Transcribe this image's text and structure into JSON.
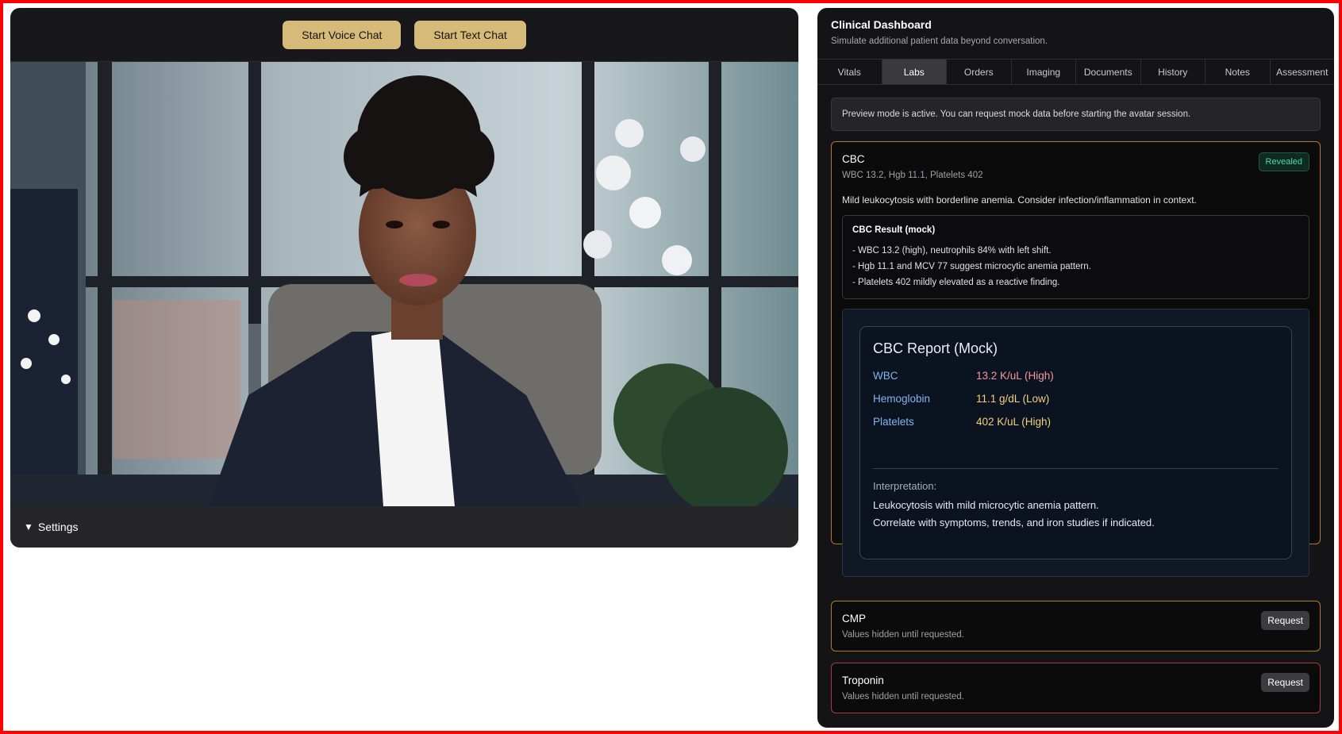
{
  "video": {
    "start_voice_label": "Start Voice Chat",
    "start_text_label": "Start Text Chat",
    "settings_label": "Settings"
  },
  "dashboard": {
    "title": "Clinical Dashboard",
    "subtitle": "Simulate additional patient data beyond conversation.",
    "tabs": [
      {
        "label": "Vitals"
      },
      {
        "label": "Labs"
      },
      {
        "label": "Orders"
      },
      {
        "label": "Imaging"
      },
      {
        "label": "Documents"
      },
      {
        "label": "History"
      },
      {
        "label": "Notes"
      },
      {
        "label": "Assessment"
      }
    ],
    "active_tab": "Labs",
    "notice": "Preview mode is active. You can request mock data before starting the avatar session."
  },
  "cbc": {
    "title": "CBC",
    "values": "WBC 13.2, Hgb 11.1, Platelets 402",
    "status": "Revealed",
    "summary": "Mild leukocytosis with borderline anemia. Consider infection/inflammation in context.",
    "result_title": "CBC Result (mock)",
    "result_lines": [
      "- WBC 13.2 (high), neutrophils 84% with left shift.",
      "- Hgb 11.1 and MCV 77 suggest microcytic anemia pattern.",
      "- Platelets 402 mildly elevated as a reactive finding."
    ],
    "report": {
      "title": "CBC Report (Mock)",
      "rows": [
        {
          "name": "WBC",
          "value": "13.2 K/uL (High)"
        },
        {
          "name": "Hemoglobin",
          "value": "11.1 g/dL (Low)"
        },
        {
          "name": "Platelets",
          "value": "402 K/uL (High)"
        }
      ],
      "interpretation_label": "Interpretation:",
      "interpretation_lines": [
        "Leukocytosis with mild microcytic anemia pattern.",
        "Correlate with symptoms, trends, and iron studies if indicated."
      ]
    }
  },
  "cmp": {
    "title": "CMP",
    "note": "Values hidden until requested.",
    "button": "Request"
  },
  "troponin": {
    "title": "Troponin",
    "note": "Values hidden until requested.",
    "button": "Request"
  },
  "colors": {
    "gold_button": "#d6ba79",
    "amber_border": "#b07a2c",
    "red_border": "#a43c44",
    "revealed_green": "#4fd8a4",
    "report_label_blue": "#7fb6ee"
  }
}
